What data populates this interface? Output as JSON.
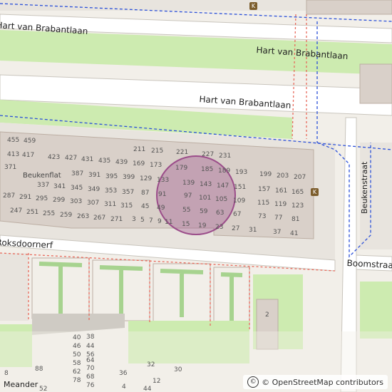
{
  "map": {
    "colors": {
      "background": "#f2efe9",
      "road": "#ffffff",
      "road_edge": "#c9c5bd",
      "grass": "#cdebb0",
      "building": "#d9d0c9",
      "building_edge": "#bcaea3",
      "parking": "#e8e4de",
      "path_red": "#e86a5c",
      "path_blue": "#2b50d9",
      "highlight": "#9b4d8a"
    },
    "streets": [
      {
        "label": "Hart van Brabantlaan"
      },
      {
        "label": "Hart van Brabantlaan"
      },
      {
        "label": "Hart van Brabantlaan"
      },
      {
        "label": "Beukenstraat"
      },
      {
        "label": "Boomstraat"
      },
      {
        "label": "Roksdoornerf"
      },
      {
        "label": "Meander"
      }
    ],
    "building_name": "Beukenflat",
    "house_numbers": [
      "455",
      "459",
      "413",
      "417",
      "423",
      "427",
      "431",
      "435",
      "439",
      "169",
      "173",
      "211",
      "215",
      "221",
      "227",
      "231",
      "371",
      "387",
      "391",
      "395",
      "399",
      "129",
      "133",
      "179",
      "185",
      "189",
      "193",
      "199",
      "203",
      "207",
      "337",
      "341",
      "345",
      "349",
      "353",
      "357",
      "87",
      "91",
      "139",
      "143",
      "147",
      "151",
      "157",
      "161",
      "165",
      "287",
      "291",
      "295",
      "299",
      "303",
      "307",
      "311",
      "315",
      "45",
      "49",
      "97",
      "101",
      "105",
      "109",
      "115",
      "119",
      "123",
      "247",
      "251",
      "255",
      "259",
      "263",
      "267",
      "271",
      "3",
      "5",
      "7",
      "9",
      "11",
      "55",
      "59",
      "63",
      "67",
      "73",
      "77",
      "81",
      "15",
      "19",
      "23",
      "27",
      "31",
      "37",
      "41",
      "40",
      "38",
      "46",
      "44",
      "50",
      "58",
      "56",
      "64",
      "62",
      "70",
      "68",
      "78",
      "76",
      "88",
      "36",
      "32",
      "30",
      "12",
      "2",
      "4",
      "44",
      "52",
      "8"
    ],
    "attribution": "© OpenStreetMap contributors",
    "highlight_circle": "address location"
  }
}
